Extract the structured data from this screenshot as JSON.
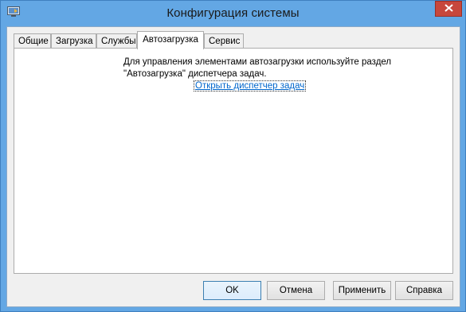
{
  "window": {
    "title": "Конфигурация системы"
  },
  "icons": {
    "app": "msconfig-icon",
    "close": "close-icon"
  },
  "tabs": [
    {
      "label": "Общие",
      "active": false
    },
    {
      "label": "Загрузка",
      "active": false
    },
    {
      "label": "Службы",
      "active": false
    },
    {
      "label": "Автозагрузка",
      "active": true
    },
    {
      "label": "Сервис",
      "active": false
    }
  ],
  "startup": {
    "message_line1": "Для управления элементами автозагрузки используйте раздел",
    "message_line2": "\"Автозагрузка\" диспетчера задач.",
    "link": "Открыть диспетчер задач"
  },
  "buttons": {
    "ok": "OK",
    "cancel": "Отмена",
    "apply": "Применить",
    "help": "Справка"
  },
  "colors": {
    "titlebar": "#63a7e4",
    "close": "#c7473c",
    "link": "#0066cc"
  }
}
